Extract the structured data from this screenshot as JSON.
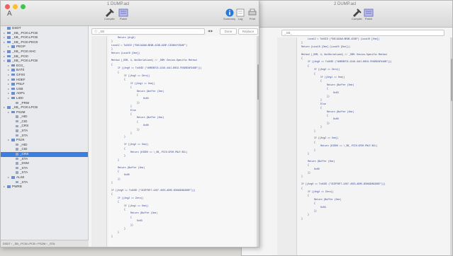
{
  "left_window": {
    "title": "1 DUMP.acl",
    "toolbar": {
      "item1_label": "Compile",
      "item2_label": "Patch",
      "right1_label": "Summary",
      "right2_label": "Log",
      "right3_label": "Print"
    },
    "search": {
      "value": "ⓢ _SB",
      "matches_label": "Done",
      "replace_label": "Replace"
    },
    "sidebar": {
      "items": [
        {
          "label": "DSDT",
          "icon": "doc-icon"
        },
        {
          "label": "_SB_.PCI0.LPCB",
          "icon": "folder-icon"
        },
        {
          "label": "_SB_.PCI0.LPCB",
          "icon": "folder-icon"
        },
        {
          "label": "_SB_.PCI0.PEG0",
          "icon": "folder-icon"
        },
        {
          "label": "PEGP",
          "icon": "folder-icon"
        },
        {
          "label": "_SB_.PCI0.XHC",
          "icon": "folder-icon"
        },
        {
          "label": "_SB_.PCI0",
          "icon": "folder-icon"
        },
        {
          "label": "_SB_.PCI0.LPCB",
          "icon": "folder-icon"
        },
        {
          "label": "EC0_",
          "icon": "folder-icon"
        },
        {
          "label": "BAT0",
          "icon": "folder-icon"
        },
        {
          "label": "GFX0",
          "icon": "folder-icon"
        },
        {
          "label": "HDEF",
          "icon": "folder-icon"
        },
        {
          "label": "PNLF",
          "icon": "folder-icon"
        },
        {
          "label": "USB",
          "icon": "folder-icon"
        },
        {
          "label": "ADP1",
          "icon": "folder-icon"
        },
        {
          "label": "LID0",
          "icon": "folder-icon"
        },
        {
          "label": "_PRW",
          "icon": "method-icon"
        },
        {
          "label": "_SB_.PCI0.LPCB",
          "icon": "folder-icon"
        },
        {
          "label": "PS2M",
          "icon": "folder-icon"
        },
        {
          "label": "_HID",
          "icon": "method-icon"
        },
        {
          "label": "_CID",
          "icon": "method-icon"
        },
        {
          "label": "_CRS",
          "icon": "method-icon"
        },
        {
          "label": "_STA",
          "icon": "method-icon"
        },
        {
          "label": "_STA",
          "icon": "method-icon"
        },
        {
          "label": "PS2K",
          "icon": "folder-icon"
        },
        {
          "label": "_HID",
          "icon": "method-icon"
        },
        {
          "label": "_CID",
          "icon": "method-icon"
        },
        {
          "label": "_CRS",
          "icon": "method-icon"
        },
        {
          "label": "_STA",
          "icon": "method-icon"
        },
        {
          "label": "_DSM",
          "icon": "method-icon"
        },
        {
          "label": "_STA",
          "icon": "method-icon"
        },
        {
          "label": "_STA",
          "icon": "method-icon"
        },
        {
          "label": "ALS0",
          "icon": "folder-icon"
        },
        {
          "label": "_STA",
          "icon": "method-icon"
        },
        {
          "label": "PWRB",
          "icon": "folder-icon"
        }
      ],
      "footer": "DSDT › _SB_.PCI0.LPCB › PS2M › _STA"
    },
    "code_lines": [
      "Return (Arg0)",
      "}",
      "Local2 = ToUUID (\"D8C1A3A6-BE9B-4C9B-91BF-C3CB81FC5DAF\")",
      "}",
      "Return (Local0 [One])",
      "",
      "Method (_DSM, 4, NotSerialized)  // _DSM: Device-Specific Method",
      "{",
      "If ((Arg0 == ToUUID (\"A0B5B7C6-1318-441C-B0C9-FE695EAF949B\")))",
      "{",
      "If ((Arg2 == Zero))",
      "{",
      "If ((Arg1 == One))",
      "{",
      "Return (Buffer (One)",
      "{",
      "0x03",
      "})",
      "}",
      "Else",
      "{",
      "Return (Buffer (One)",
      "{",
      "0x00",
      "})",
      "}",
      "}",
      "",
      "If ((Arg2 == One))",
      "{",
      "Return (HIDD0 == \\_SB_.PCI0.GFX0.PNLF.BCL)",
      "}",
      "}",
      "",
      "Return (Buffer (One)",
      "{",
      "0x00",
      "})",
      "}",
      "",
      "If ((Arg0 == ToUUID (\"3CDFF6F7-4267-4555-AD05-B30A3D8938DE\")))",
      "{",
      "If ((Arg2 == Zero))",
      "{",
      "If ((Arg1 == One))",
      "{",
      "Return (Buffer (One)",
      "{",
      "0x03",
      "})",
      "}",
      "}",
      "}"
    ]
  },
  "right_window": {
    "title": "2 DUMP.acl",
    "toolbar": {
      "item1_label": "Compile",
      "item2_label": "Patch"
    },
    "search": {
      "value": "_SB_"
    },
    "code_lines": [
      "Local2 = ToUUID (\"D8C1A3A6-BE9B-4C9B\") (Local0 [One])",
      "}",
      "Return (Local0 [One] (Local0 [One]))",
      "",
      "Method (_DSM, 4, NotSerialized)  // _DSM: Device-Specific Method",
      "{",
      "If ((Arg0 == ToUUID (\"A0B5B7C6-1318-441C-B0C9-FE695EAF949B\")))",
      "{",
      "If ((Arg2 == Zero))",
      "{",
      "If ((Arg1 == One))",
      "{",
      "Return (Buffer (One)",
      "{",
      "0x03",
      "})",
      "}",
      "Else",
      "{",
      "Return (Buffer (One)",
      "{",
      "0x00",
      "})",
      "}",
      "}",
      "",
      "If ((Arg2 == One))",
      "{",
      "Return (HIDD0 == \\_SB_.PCI0.GFX0.PNLF.BCL)",
      "}",
      "}",
      "",
      "Return (Buffer (One)",
      "{",
      "0x00",
      "})",
      "}",
      "",
      "If ((Arg0 == ToUUID (\"3CDFF6F7-4267-4555-AD05-B30A3D8938DE\")))",
      "{",
      "If ((Arg2 == Zero))",
      "{",
      "Return (Buffer (One)",
      "{",
      "0x03",
      "})",
      "}",
      "}"
    ]
  },
  "colors": {
    "code_text": "#2a3a8c",
    "selection": "#3b7ee0",
    "info_icon": "#2a79d8"
  }
}
